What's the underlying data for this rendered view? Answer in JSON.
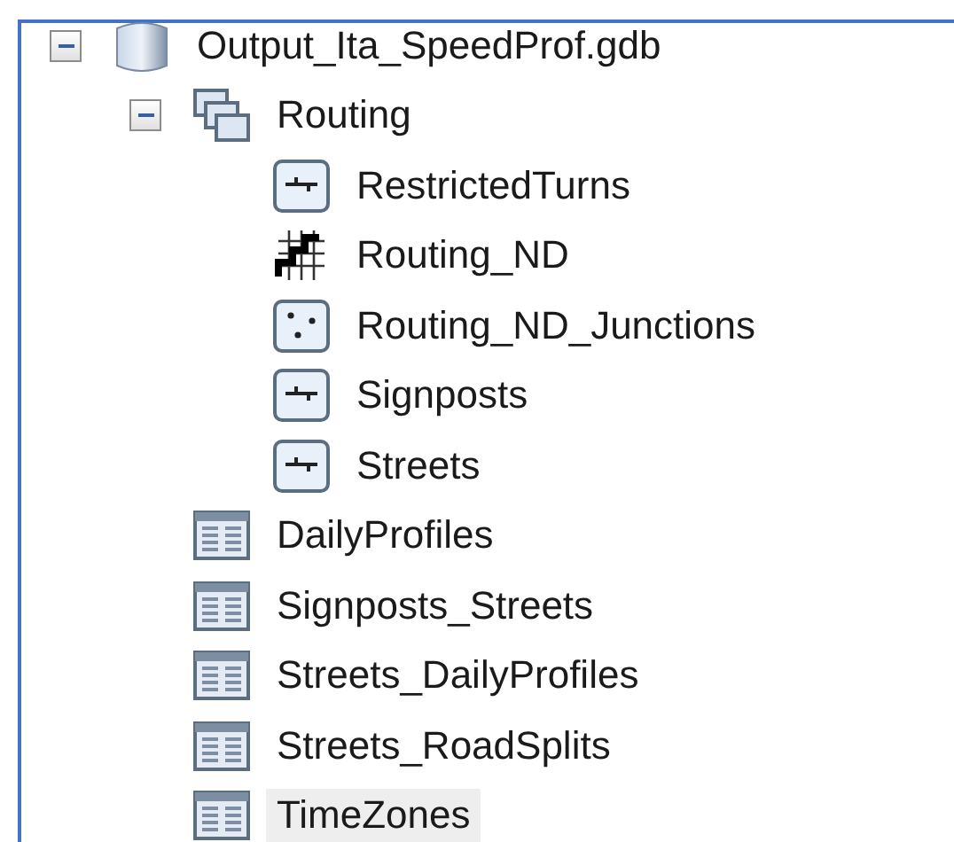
{
  "tree": [
    {
      "label": "Output_Ita_SpeedProf.gdb",
      "kind": "database",
      "expanded": true,
      "selected": false,
      "children": [
        {
          "label": "Routing",
          "kind": "dataset",
          "expanded": true,
          "selected": false,
          "children": [
            {
              "label": "RestrictedTurns",
              "kind": "line",
              "selected": false
            },
            {
              "label": "Routing_ND",
              "kind": "network",
              "selected": false
            },
            {
              "label": "Routing_ND_Junctions",
              "kind": "point",
              "selected": false
            },
            {
              "label": "Signposts",
              "kind": "line",
              "selected": false
            },
            {
              "label": "Streets",
              "kind": "line",
              "selected": false
            }
          ]
        },
        {
          "label": "DailyProfiles",
          "kind": "table",
          "selected": false
        },
        {
          "label": "Signposts_Streets",
          "kind": "table",
          "selected": false
        },
        {
          "label": "Streets_DailyProfiles",
          "kind": "table",
          "selected": false
        },
        {
          "label": "Streets_RoadSplits",
          "kind": "table",
          "selected": false
        },
        {
          "label": "TimeZones",
          "kind": "table",
          "selected": true
        }
      ]
    }
  ]
}
